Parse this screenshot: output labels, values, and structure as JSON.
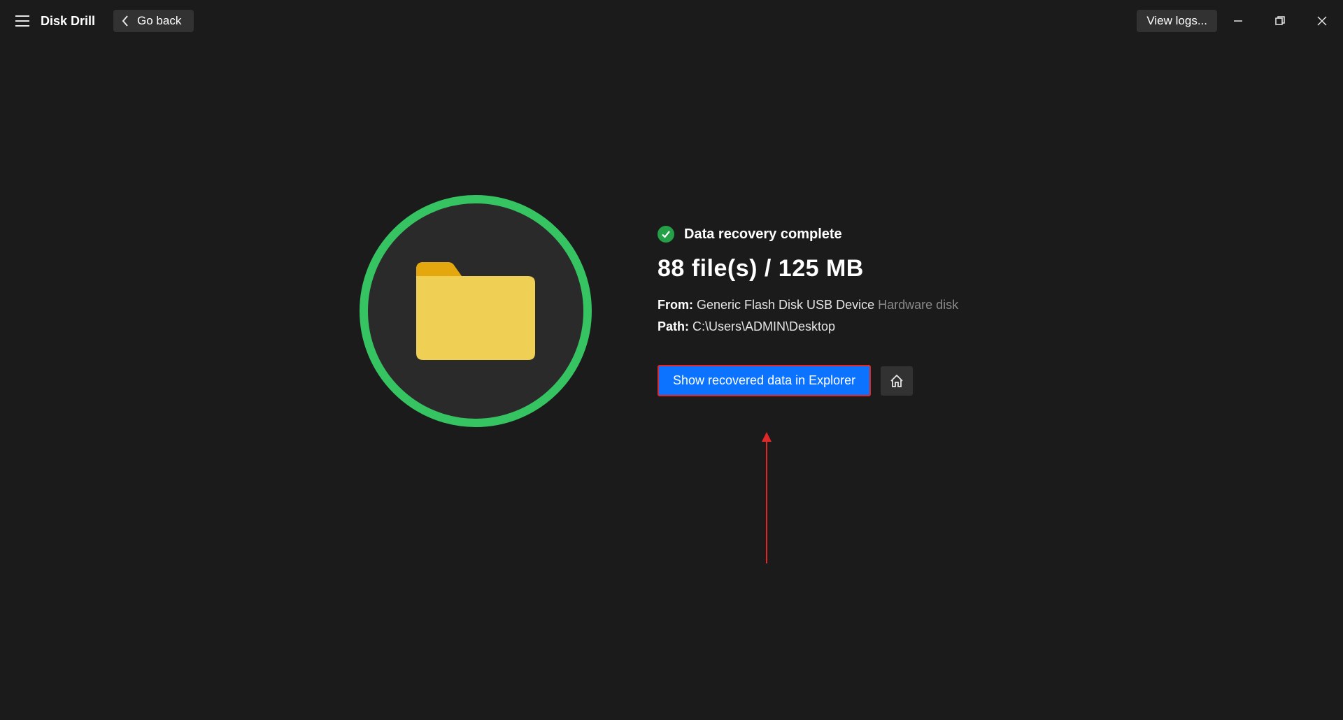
{
  "app": {
    "title": "Disk Drill"
  },
  "topbar": {
    "go_back_label": "Go back",
    "view_logs_label": "View logs..."
  },
  "result": {
    "status_text": "Data recovery complete",
    "summary": "88 file(s) / 125 MB",
    "from_label": "From:",
    "from_value": "Generic Flash Disk USB Device",
    "from_hint": "Hardware disk",
    "path_label": "Path:",
    "path_value": "C:\\Users\\ADMIN\\Desktop",
    "show_button": "Show recovered data in Explorer"
  },
  "colors": {
    "accent_green": "#36c463",
    "folder_yellow": "#f0cf55",
    "folder_tab": "#e4a80e",
    "button_blue": "#0b73ff",
    "annotation_red": "#e12828"
  }
}
